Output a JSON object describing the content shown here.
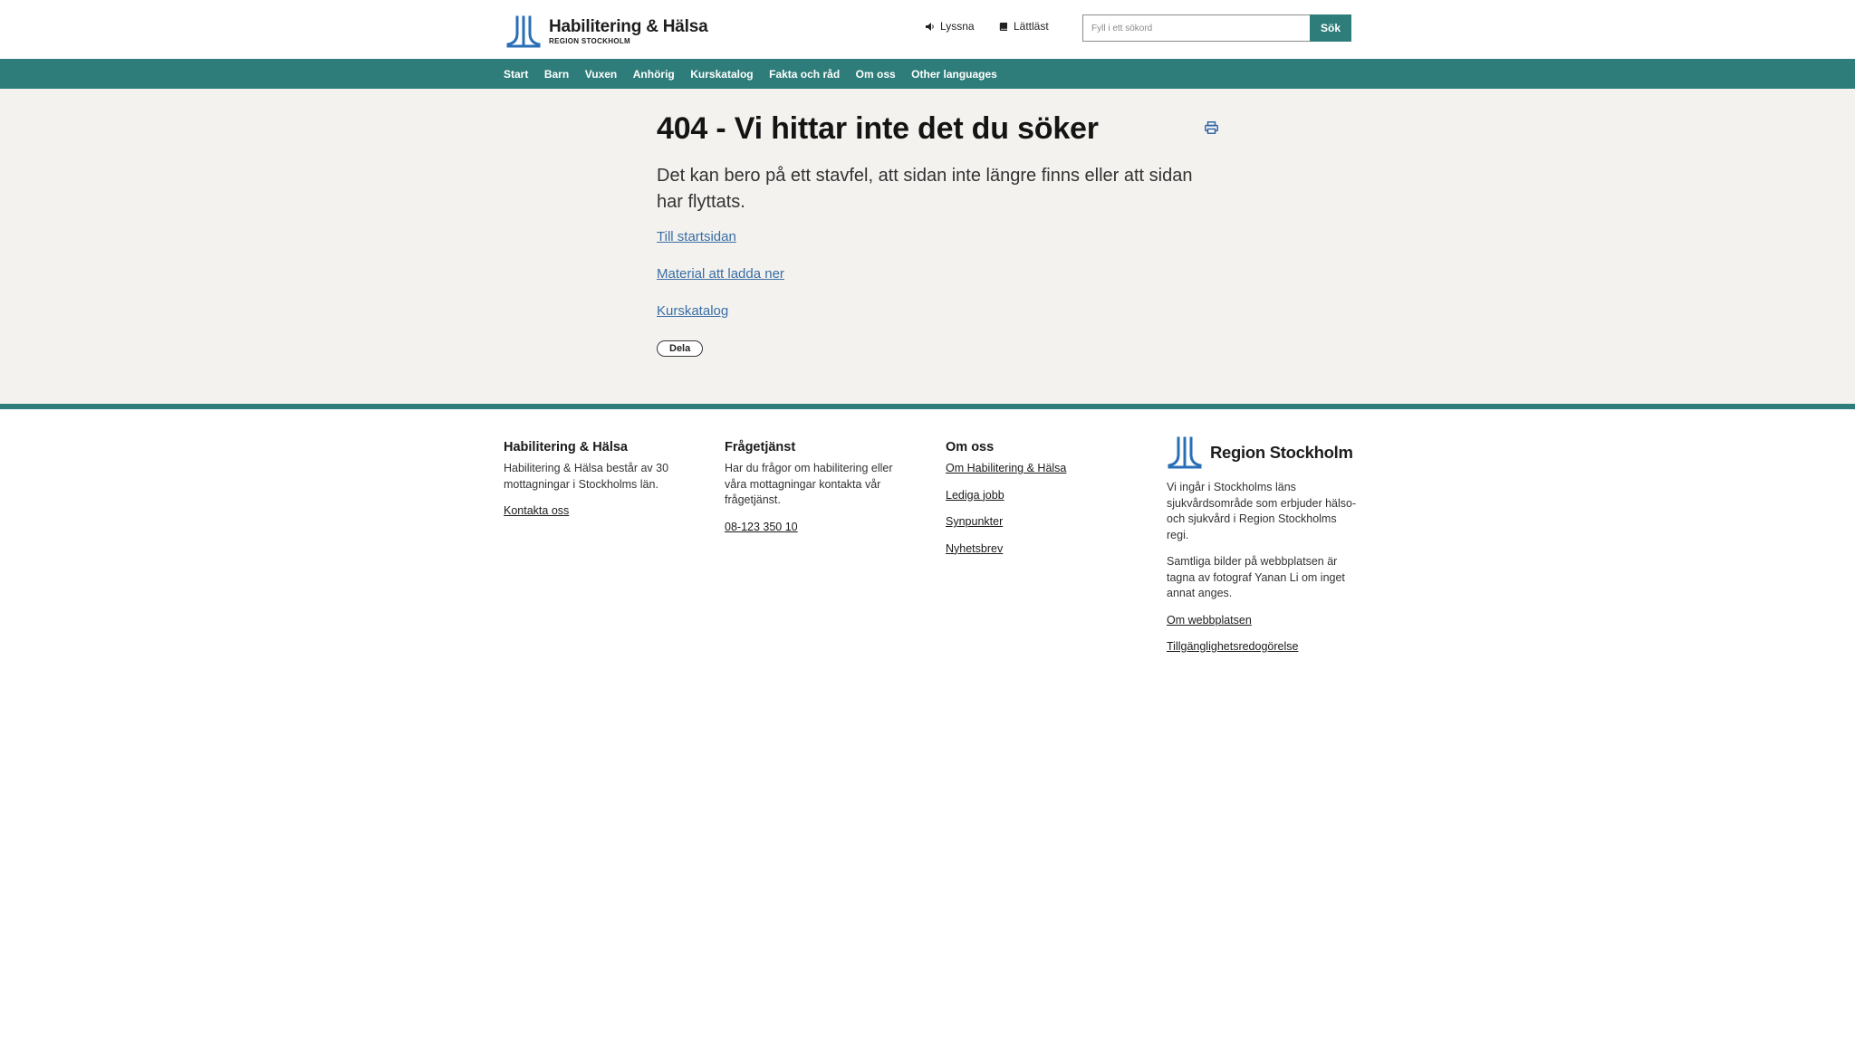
{
  "brand": {
    "title": "Habilitering & Hälsa",
    "subtitle": "REGION STOCKHOLM",
    "accent_color": "#2e7d7a",
    "logo_blue": "#2a6fb6"
  },
  "header": {
    "listen_label": "Lyssna",
    "listen_icon": "speaker-icon",
    "easy_read_label": "Lättläst",
    "easy_read_icon": "book-icon",
    "search_placeholder": "Fyll i ett sökord",
    "search_button": "Sök"
  },
  "nav": {
    "items": [
      {
        "label": "Start"
      },
      {
        "label": "Barn"
      },
      {
        "label": "Vuxen"
      },
      {
        "label": "Anhörig"
      },
      {
        "label": "Kurskatalog"
      },
      {
        "label": "Fakta och råd"
      },
      {
        "label": "Om oss"
      },
      {
        "label": "Other languages"
      }
    ]
  },
  "main": {
    "title": "404 - Vi hittar inte det du söker",
    "lead": "Det kan bero på ett stavfel, att sidan inte längre finns eller att sidan har flyttats.",
    "links": [
      {
        "label": "Till startsidan"
      },
      {
        "label": "Material att ladda ner"
      },
      {
        "label": "Kurskatalog"
      }
    ],
    "share_label": "Dela",
    "print_icon": "printer-icon"
  },
  "footer": {
    "col1": {
      "heading": "Habilitering & Hälsa",
      "text": "Habilitering & Hälsa består av 30 mottagningar i Stockholms län.",
      "link": "Kontakta oss"
    },
    "col2": {
      "heading": "Frågetjänst",
      "text": "Har du frågor om habilitering eller våra mottagningar kontakta vår frågetjänst.",
      "link": "08-123 350 10"
    },
    "col3": {
      "heading": "Om oss",
      "links": [
        {
          "label": "Om Habilitering & Hälsa"
        },
        {
          "label": "Lediga jobb"
        },
        {
          "label": "Synpunkter"
        },
        {
          "label": "Nyhetsbrev"
        }
      ]
    },
    "col4": {
      "logo_text": "Region Stockholm",
      "text1": "Vi ingår i Stockholms läns sjukvårdsområde som erbjuder hälso- och sjukvård i Region Stockholms regi.",
      "text2": "Samtliga bilder på webbplatsen är tagna av fotograf Yanan Li om inget annat anges.",
      "links": [
        {
          "label": "Om webbplatsen"
        },
        {
          "label": "Tillgänglighetsredogörelse"
        }
      ]
    }
  }
}
